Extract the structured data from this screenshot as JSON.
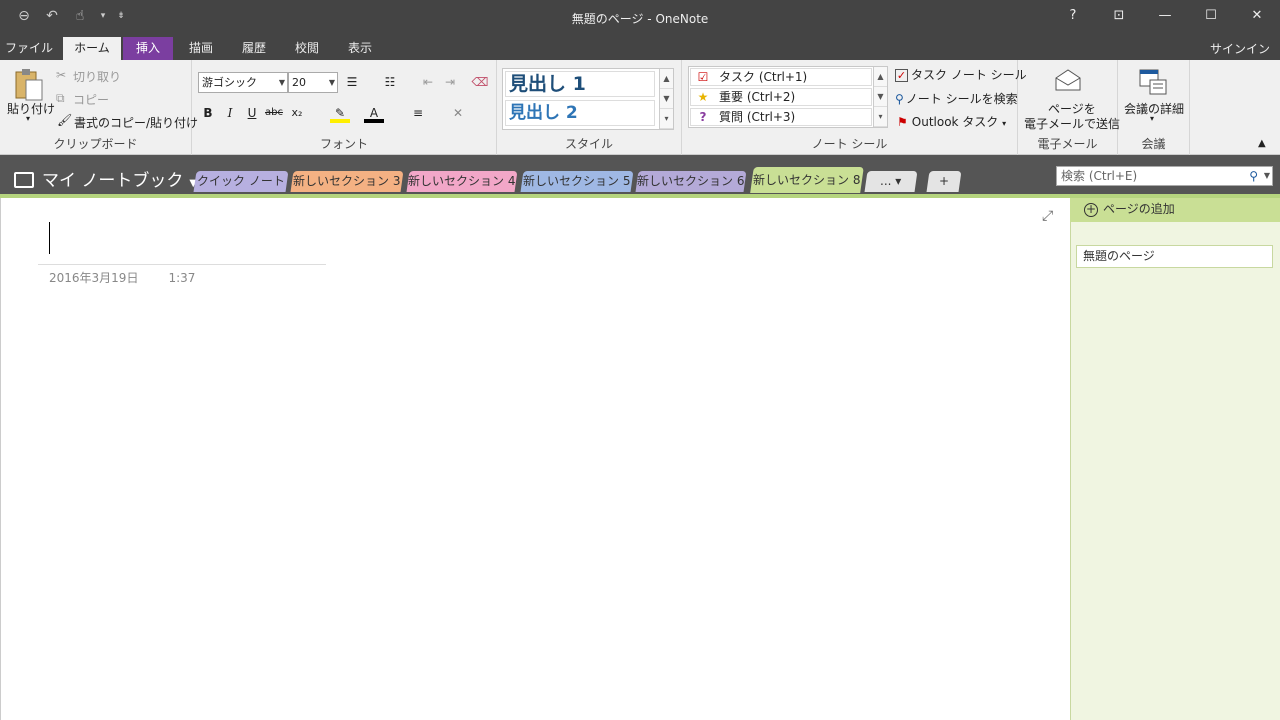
{
  "window": {
    "title": "無題のページ - OneNote",
    "help": "?",
    "ribbon_display": "⊡",
    "minimize": "—",
    "maximize": "☐",
    "close": "✕"
  },
  "qat": {
    "back": "⊖",
    "undo": "↶",
    "touch": "☝",
    "touch_arrow": "▾",
    "customize": "⇟"
  },
  "menu": {
    "tabs": [
      "ファイル",
      "ホーム",
      "挿入",
      "描画",
      "履歴",
      "校閲",
      "表示"
    ],
    "signin": "サインイン"
  },
  "ribbon": {
    "clipboard": {
      "label": "クリップボード",
      "paste": "貼り付け",
      "cut": "切り取り",
      "copy": "コピー",
      "format_paint": "書式のコピー/貼り付け"
    },
    "font": {
      "label": "フォント",
      "family": "游ゴシック",
      "size": "20",
      "bold": "B",
      "italic": "I",
      "underline": "U",
      "strike": "abc",
      "subscript": "x₂"
    },
    "styles": {
      "label": "スタイル",
      "h1": "見出し 1",
      "h2": "見出し 2"
    },
    "tags": {
      "label": "ノート シール",
      "task": "タスク (Ctrl+1)",
      "important": "重要 (Ctrl+2)",
      "question": "質問 (Ctrl+3)",
      "todo_tag": "タスク ノート シール",
      "find_tags": "ノート シールを検索",
      "outlook_tasks": "Outlook タスク"
    },
    "email": {
      "label": "電子メール",
      "send_line1": "ページを",
      "send_line2": "電子メールで送信"
    },
    "meetings": {
      "label": "会議",
      "details": "会議の詳細"
    }
  },
  "notebook": {
    "name": "マイ ノートブック"
  },
  "sections": [
    {
      "label": "クイック ノート",
      "color": "#b7b0e0"
    },
    {
      "label": "新しいセクション 3",
      "color": "#f4b183"
    },
    {
      "label": "新しいセクション 4",
      "color": "#f2a7c8"
    },
    {
      "label": "新しいセクション 5",
      "color": "#9fb8e4"
    },
    {
      "label": "新しいセクション 6",
      "color": "#b4aad8"
    },
    {
      "label": "新しいセクション 8",
      "color": "#c9df95"
    }
  ],
  "section_more": "... ▾",
  "section_add": "+",
  "search": {
    "placeholder": "検索 (Ctrl+E)"
  },
  "page": {
    "date": "2016年3月19日",
    "time": "1:37"
  },
  "pages_panel": {
    "add_page": "ページの追加",
    "pages": [
      "無題のページ"
    ]
  }
}
